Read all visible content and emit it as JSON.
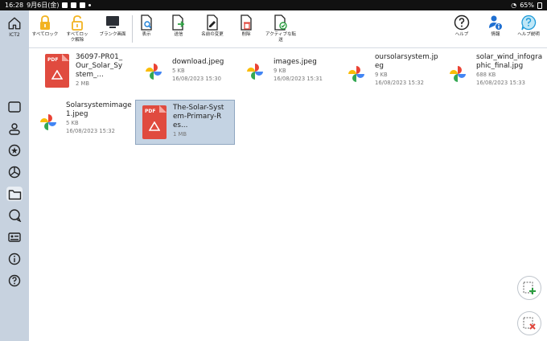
{
  "status": {
    "time": "16:28",
    "date": "9月6日(金)",
    "battery": "65%"
  },
  "rail": {
    "home_label": "ICT2"
  },
  "toolbar": {
    "lock_all": "すべてロック",
    "unlock_all": "すべてロック解除",
    "blank_screen": "ブランク画面",
    "view": "表示",
    "send": "送信",
    "rename": "名前の変更",
    "delete": "削除",
    "active_transfer": "アクティブな転送",
    "help": "ヘルプ",
    "info": "情報",
    "help_desc": "ヘルプ説明"
  },
  "files": [
    {
      "name": "36097-PR01_Our_Solar_System_...",
      "size": "2 MB",
      "date": "",
      "type": "pdf"
    },
    {
      "name": "download.jpeg",
      "size": "5 KB",
      "date": "16/08/2023 15:30",
      "type": "image"
    },
    {
      "name": "images.jpeg",
      "size": "9 KB",
      "date": "16/08/2023 15:31",
      "type": "image"
    },
    {
      "name": "oursolarsystem.jpeg",
      "size": "9 KB",
      "date": "16/08/2023 15:32",
      "type": "image"
    },
    {
      "name": "solar_wind_infographic_final.jpg",
      "size": "688 KB",
      "date": "16/08/2023 15:33",
      "type": "image"
    },
    {
      "name": "Solarsystemimage1.jpeg",
      "size": "5 KB",
      "date": "16/08/2023 15:32",
      "type": "image"
    },
    {
      "name": "The-Solar-System-Primary-Res...",
      "size": "1 MB",
      "date": "",
      "type": "pdf",
      "selected": true
    }
  ]
}
